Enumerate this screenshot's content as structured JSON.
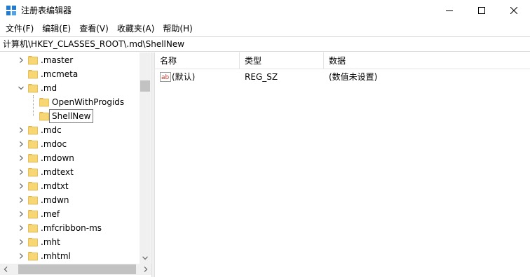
{
  "window": {
    "title": "注册表编辑器",
    "icon": "regedit-icon",
    "controls": [
      "minimize-icon",
      "maximize-icon",
      "close-icon"
    ]
  },
  "menu": {
    "items": [
      "文件(F)",
      "编辑(E)",
      "查看(V)",
      "收藏夹(A)",
      "帮助(H)"
    ]
  },
  "address": {
    "path": "计算机\\HKEY_CLASSES_ROOT\\.md\\ShellNew"
  },
  "tree": {
    "items": [
      {
        "label": ".master",
        "arrow": "collapsed"
      },
      {
        "label": ".mcmeta",
        "arrow": "none"
      },
      {
        "label": ".md",
        "arrow": "expanded"
      },
      {
        "label": "OpenWithProgids",
        "arrow": "none"
      },
      {
        "label": "ShellNew",
        "arrow": "none",
        "selected": true
      },
      {
        "label": ".mdc",
        "arrow": "collapsed"
      },
      {
        "label": ".mdoc",
        "arrow": "collapsed"
      },
      {
        "label": ".mdown",
        "arrow": "collapsed"
      },
      {
        "label": ".mdtext",
        "arrow": "collapsed"
      },
      {
        "label": ".mdtxt",
        "arrow": "collapsed"
      },
      {
        "label": ".mdwn",
        "arrow": "collapsed"
      },
      {
        "label": ".mef",
        "arrow": "collapsed"
      },
      {
        "label": ".mfcribbon-ms",
        "arrow": "collapsed"
      },
      {
        "label": ".mht",
        "arrow": "collapsed"
      },
      {
        "label": ".mhtml",
        "arrow": "collapsed"
      }
    ]
  },
  "list": {
    "columns": [
      "名称",
      "类型",
      "数据"
    ],
    "rows": [
      {
        "icon": "string-value-icon",
        "name": "(默认)",
        "type": "REG_SZ",
        "data": "(数值未设置)"
      }
    ]
  },
  "colors": {
    "folder": "#f7d774",
    "folder_edge": "#e0b44c",
    "icon_blue": "#1e7bd6",
    "ab_red": "#c0392b"
  }
}
